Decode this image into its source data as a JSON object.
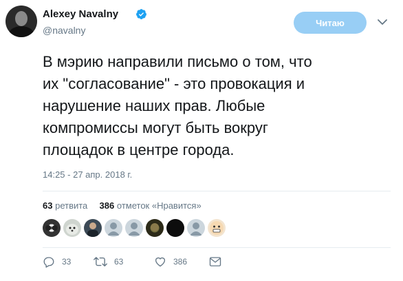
{
  "tweet": {
    "author_name": "Alexey Navalny",
    "author_handle": "@navalny",
    "follow_button_label": "Читаю",
    "text": "В мэрию направили письмо о том, что\nих \"согласование\" - это провокация и\nнарушение наших прав. Любые\nкомпромиссы могут быть вокруг\nплощадок в центре города.",
    "timestamp": "14:25 - 27 апр. 2018 г.",
    "retweets_count": "63",
    "retweets_label": "ретвита",
    "likes_count": "386",
    "likes_label": "отметок «Нравится»",
    "actions": {
      "replies": "33",
      "retweets": "63",
      "likes": "386"
    }
  },
  "colors": {
    "accent": "#1da1f2",
    "follow_bg": "#98cef5",
    "secondary_text": "#657786",
    "divider": "#e6ecf0"
  },
  "icons": {
    "verified": "verified-badge-icon",
    "caret": "chevron-down-icon",
    "reply": "reply-icon",
    "retweet": "retweet-icon",
    "like": "heart-icon",
    "dm": "envelope-icon"
  }
}
